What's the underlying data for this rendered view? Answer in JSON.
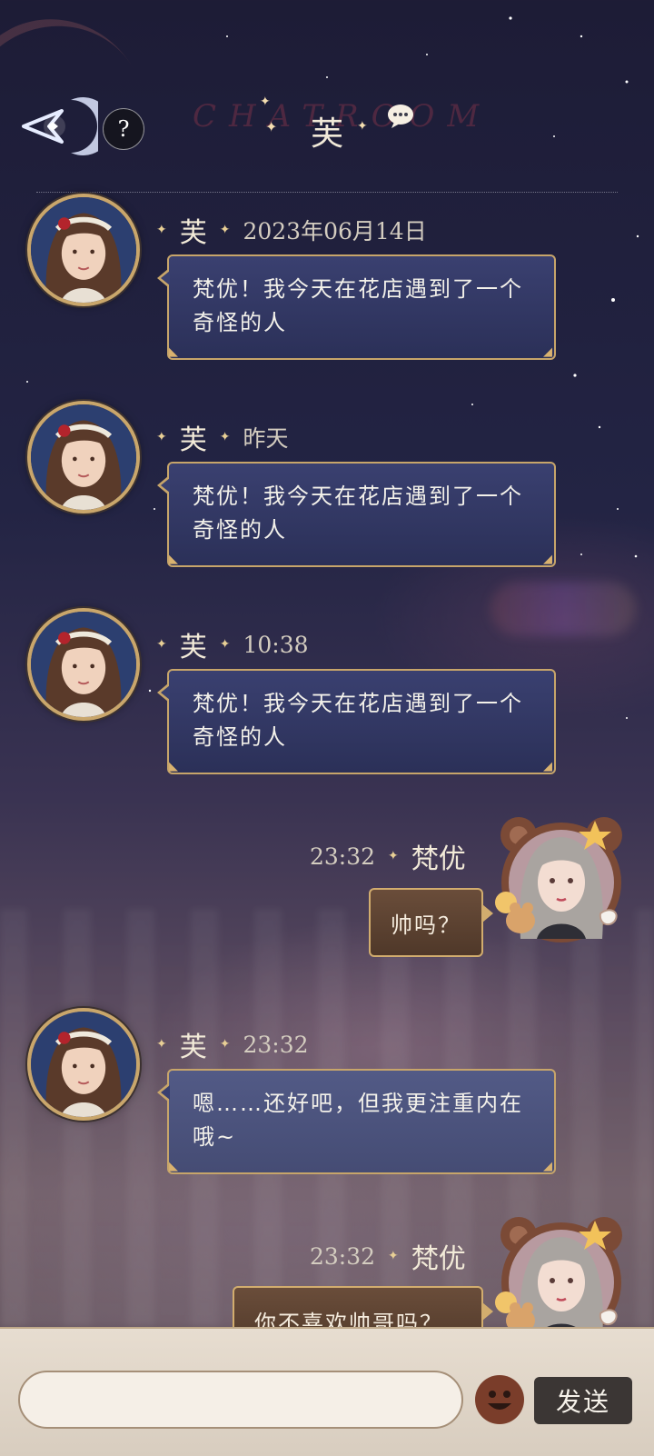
{
  "header": {
    "title": "芙",
    "background_text": "CHATROOM",
    "help_label": "?"
  },
  "messages": [
    {
      "sender": "芙",
      "side": "left",
      "time": "2023年06月14日",
      "text": "梵优！我今天在花店遇到了一个奇怪的人"
    },
    {
      "sender": "芙",
      "side": "left",
      "time": "昨天",
      "text": "梵优！我今天在花店遇到了一个奇怪的人"
    },
    {
      "sender": "芙",
      "side": "left",
      "time": "10:38",
      "text": "梵优！我今天在花店遇到了一个奇怪的人"
    },
    {
      "sender": "梵优",
      "side": "right",
      "time": "23:32",
      "text": "帅吗？"
    },
    {
      "sender": "芙",
      "side": "left",
      "time": "23:32",
      "text": "嗯……还好吧，但我更注重内在哦~"
    },
    {
      "sender": "梵优",
      "side": "right",
      "time": "23:32",
      "text": "你不喜欢帅哥吗？"
    }
  ],
  "input": {
    "value": "",
    "placeholder": "",
    "send_label": "发送"
  },
  "colors": {
    "bubble_left": "#2f3460",
    "bubble_right": "#5c4232",
    "bubble_border": "#c7a56a",
    "send_button": "#3b3634"
  },
  "icons": [
    "back-arrow-icon",
    "help-icon",
    "chat-bubble-icon",
    "emoji-icon"
  ]
}
